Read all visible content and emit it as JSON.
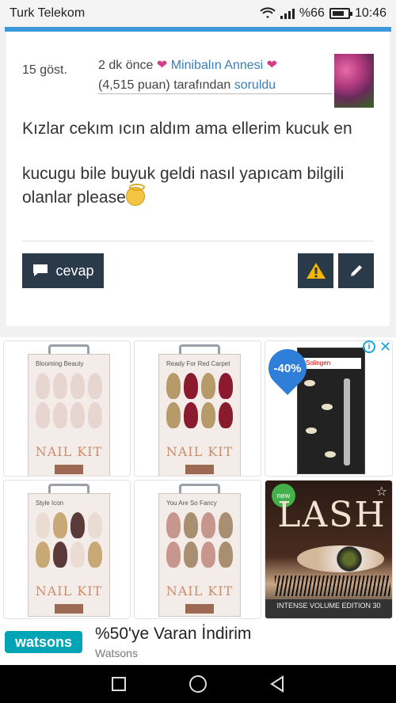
{
  "status_bar": {
    "carrier": "Turk Telekom",
    "battery_text": "%66",
    "time": "10:46"
  },
  "post": {
    "views": "15 göst.",
    "time_ago": "2 dk önce",
    "author": "Minibalın Annesi",
    "points": "(4,515 puan)",
    "by_text": "tarafından",
    "asked_text": "soruldu",
    "question_line1": "Kızlar cekım ıcın aldım ama ellerim kucuk en",
    "question_line2": "kucugu bile buyuk geldi nasıl yapıcam bilgili olanlar please"
  },
  "actions": {
    "reply_label": "cevap"
  },
  "ads": {
    "tiles": [
      {
        "small_text": "Blooming Beauty",
        "kit_text": "NAIL KIT"
      },
      {
        "small_text": "Ready For Red Carpet",
        "kit_text": "NAIL KIT"
      },
      {
        "discount": "-40%",
        "brand": "Solingen"
      },
      {
        "small_text": "Style Icon",
        "kit_text": "NAIL KIT"
      },
      {
        "small_text": "You Are So Fancy",
        "kit_text": "NAIL KIT"
      },
      {
        "badge": "new",
        "title": "LASH",
        "band": "INTENSE VOLUME EDITION 30"
      }
    ],
    "info_icon": "i",
    "close_icon": "✕",
    "banner": {
      "logo": "watsons",
      "title": "%50'ye Varan İndirim",
      "subtitle": "Watsons"
    }
  },
  "colors": {
    "accent": "#3a9ad9",
    "button": "#2b3a48",
    "heart": "#d63f87",
    "link": "#3a7fb5",
    "warning": "#f2b705",
    "watsons": "#00a5b5"
  }
}
